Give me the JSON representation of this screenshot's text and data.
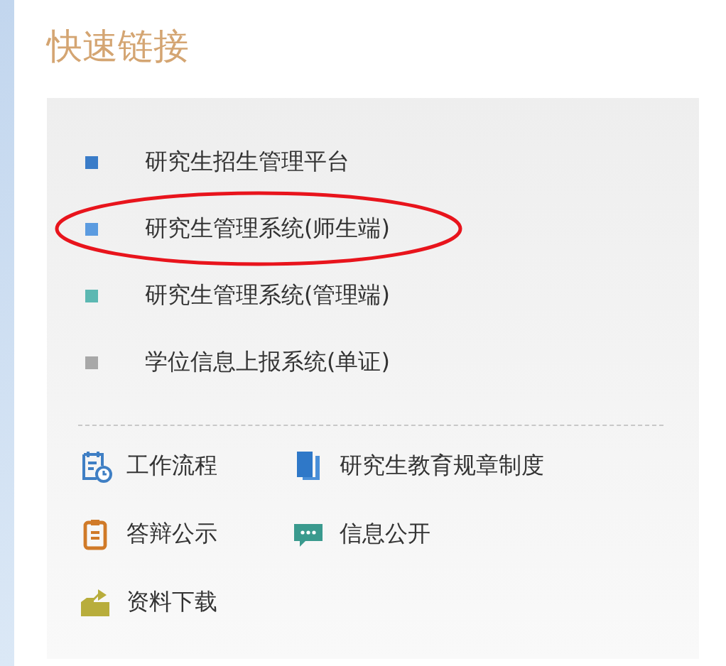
{
  "title": "快速链接",
  "links": [
    {
      "label": "研究生招生管理平台",
      "color": "#3a7cc8",
      "circled": false
    },
    {
      "label": "研究生管理系统(师生端)",
      "color": "#5b9be0",
      "circled": true
    },
    {
      "label": "研究生管理系统(管理端)",
      "color": "#5cb8b2",
      "circled": false
    },
    {
      "label": "学位信息上报系统(单证)",
      "color": "#a8a8a8",
      "circled": false
    }
  ],
  "shortcuts": [
    {
      "label": "工作流程",
      "kind": "workflow"
    },
    {
      "label": "研究生教育规章制度",
      "kind": "book"
    },
    {
      "label": "答辩公示",
      "kind": "clipboard"
    },
    {
      "label": "信息公开",
      "kind": "chat"
    },
    {
      "label": "资料下载",
      "kind": "folder"
    }
  ]
}
